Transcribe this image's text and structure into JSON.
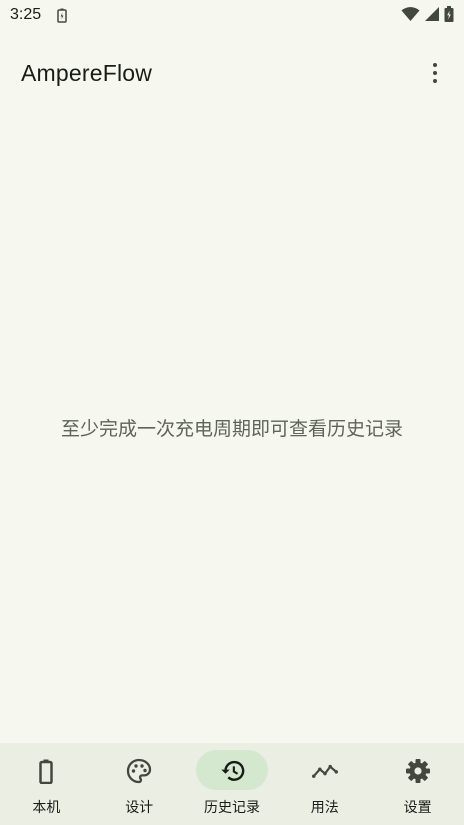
{
  "status_bar": {
    "time": "3:25"
  },
  "app_bar": {
    "title": "AmpereFlow"
  },
  "main": {
    "empty_message": "至少完成一次充电周期即可查看历史记录"
  },
  "bottom_nav": {
    "items": [
      {
        "label": "本机",
        "icon": "battery-icon",
        "active": false
      },
      {
        "label": "设计",
        "icon": "palette-icon",
        "active": false
      },
      {
        "label": "历史记录",
        "icon": "history-icon",
        "active": true
      },
      {
        "label": "用法",
        "icon": "trend-line-icon",
        "active": false
      },
      {
        "label": "设置",
        "icon": "gear-icon",
        "active": false
      }
    ]
  },
  "colors": {
    "background": "#f6f8f0",
    "nav_background": "#ebeee3",
    "active_indicator": "#d3e8cf",
    "icon": "#43483e"
  }
}
